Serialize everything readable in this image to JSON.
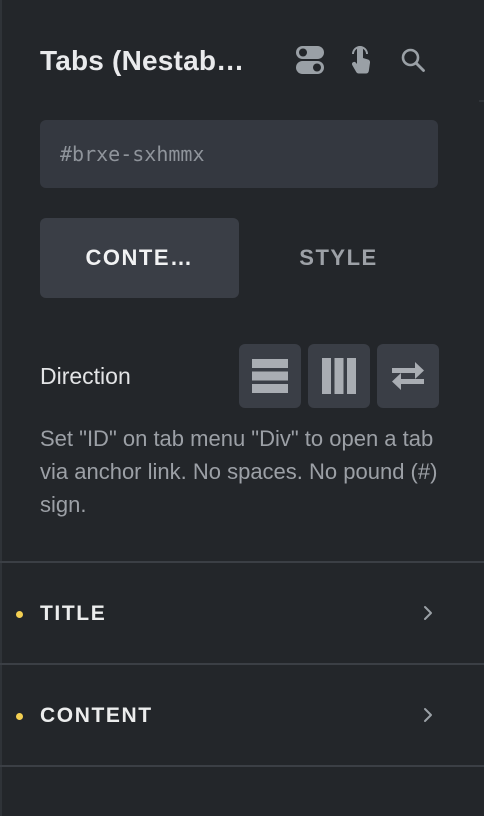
{
  "header": {
    "title": "Tabs (Nestab…",
    "icons": [
      "toggle-icon",
      "pointer-hand-icon",
      "search-icon"
    ]
  },
  "id_field": {
    "value": "#brxe-sxhmmx"
  },
  "tabs": [
    {
      "label": "CONTE…",
      "active": true
    },
    {
      "label": "STYLE",
      "active": false
    }
  ],
  "direction": {
    "label": "Direction",
    "options": [
      "rows-icon",
      "columns-icon",
      "reverse-icon"
    ]
  },
  "help_text": "Set \"ID\" on tab menu \"Div\" to open a tab via anchor link. No spaces. No pound (#) sign.",
  "groups": [
    {
      "label": "TITLE",
      "indicator_color": "#f3cf52"
    },
    {
      "label": "CONTENT",
      "indicator_color": "#f3cf52"
    }
  ]
}
